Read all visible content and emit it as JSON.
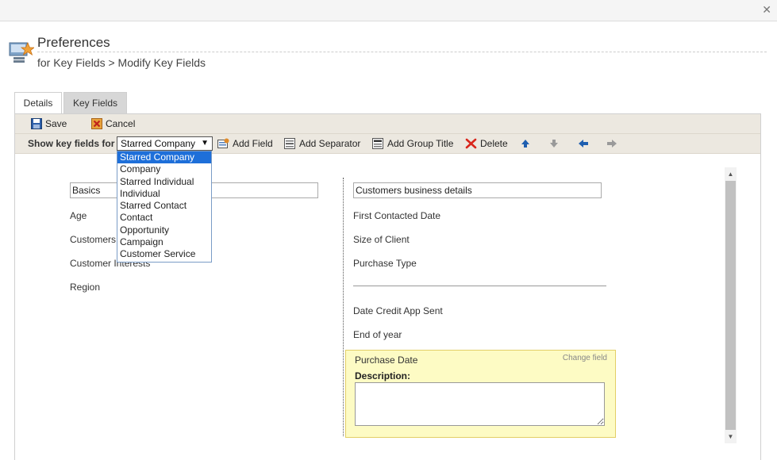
{
  "window": {
    "close_label": "✕"
  },
  "header": {
    "title": "Preferences",
    "breadcrumb": "for Key Fields > Modify Key Fields",
    "icon": "preferences-star-icon"
  },
  "tabs": [
    {
      "label": "Details",
      "active": false
    },
    {
      "label": "Key Fields",
      "active": true
    }
  ],
  "toolbar": {
    "save_label": "Save",
    "cancel_label": "Cancel",
    "show_key_fields_label": "Show key fields for",
    "selected_option": "Starred Company",
    "add_field_label": "Add Field",
    "add_separator_label": "Add Separator",
    "add_group_title_label": "Add Group Title",
    "delete_label": "Delete"
  },
  "dropdown": {
    "options": [
      "Starred Company",
      "Company",
      "Starred Individual",
      "Individual",
      "Starred Contact",
      "Contact",
      "Opportunity",
      "Campaign",
      "Customer Service"
    ],
    "selected_index": 0
  },
  "left_column": {
    "group_title": "Basics",
    "fields": [
      "Age",
      "Customers",
      "Customer Interests",
      "Region"
    ]
  },
  "right_column": {
    "group_title": "Customers business details",
    "fields_before_separator": [
      "First Contacted Date",
      "Size of Client",
      "Purchase Type"
    ],
    "fields_after_separator": [
      "Date Credit App Sent",
      "End of year"
    ],
    "selected_field": {
      "label": "Purchase Date",
      "change_label": "Change field",
      "description_label": "Description:",
      "description_value": ""
    }
  },
  "colors": {
    "toolbar_bg": "#ece8e0",
    "highlight_bg": "#fdfbc4",
    "highlight_border": "#e3cf66",
    "dropdown_selected": "#1e6fd9",
    "delete_red": "#d9261c",
    "arrow_blue": "#1f5fb0"
  }
}
